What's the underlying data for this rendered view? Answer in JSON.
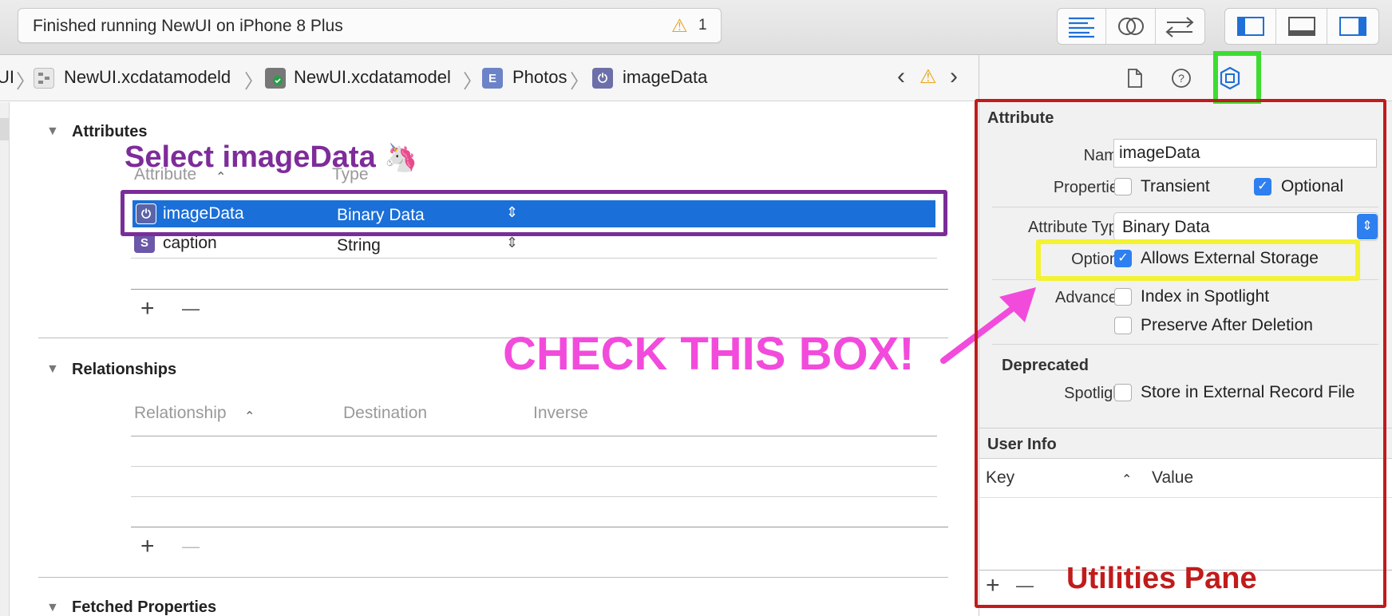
{
  "toolbar": {
    "status_text": "Finished running NewUI on iPhone 8 Plus",
    "warning_icon": "warning-triangle-icon",
    "warning_count": "1",
    "editor_buttons": [
      "standard-editor-icon",
      "assistant-editor-icon",
      "version-editor-icon"
    ],
    "view_buttons": [
      "navigator-toggle-icon",
      "debug-area-toggle-icon",
      "utilities-toggle-icon"
    ]
  },
  "jumpbar": {
    "crumbs": [
      {
        "label": "UI",
        "icon": ""
      },
      {
        "label": "NewUI.xcdatamodeld",
        "icon": "datamodel-bundle-icon"
      },
      {
        "label": "NewUI.xcdatamodel",
        "icon": "datamodel-file-icon"
      },
      {
        "label": "Photos",
        "icon": "entity-icon",
        "icon_letter": "E"
      },
      {
        "label": "imageData",
        "icon": "attribute-icon"
      }
    ],
    "nav_back": "‹",
    "nav_forward": "›"
  },
  "editor": {
    "attributes": {
      "title": "Attributes",
      "columns": [
        "Attribute",
        "Type"
      ],
      "rows": [
        {
          "name": "imageData",
          "type": "Binary Data",
          "icon_letter": "⏻",
          "selected": true
        },
        {
          "name": "caption",
          "type": "String",
          "icon_letter": "S",
          "selected": false
        }
      ]
    },
    "relationships": {
      "title": "Relationships",
      "columns": [
        "Relationship",
        "Destination",
        "Inverse"
      ]
    },
    "fetched_properties": {
      "title": "Fetched Properties"
    },
    "add_label": "+",
    "remove_label": "—"
  },
  "inspector": {
    "tab_icons": [
      "file-inspector-icon",
      "quick-help-icon",
      "data-model-inspector-icon"
    ],
    "section_title": "Attribute",
    "name_label": "Name",
    "name_value": "imageData",
    "properties_label": "Properties",
    "transient_label": "Transient",
    "transient_checked": false,
    "optional_label": "Optional",
    "optional_checked": true,
    "attribute_type_label": "Attribute Type",
    "attribute_type_value": "Binary Data",
    "options_label": "Options",
    "allows_external_label": "Allows External Storage",
    "allows_external_checked": true,
    "advanced_label": "Advanced",
    "index_spotlight_label": "Index in Spotlight",
    "preserve_label": "Preserve After Deletion",
    "deprecated_title": "Deprecated",
    "spotlight_label": "Spotlight",
    "store_external_label": "Store in External Record File",
    "user_info_title": "User Info",
    "key_col": "Key",
    "value_col": "Value",
    "add_label": "+",
    "remove_label": "—"
  },
  "annotations": {
    "select_text": "Select imageData",
    "select_emoji": "🦄",
    "check_text": "CHECK THIS BOX!",
    "utilities_text": "Utilities Pane"
  },
  "colors": {
    "selection_blue": "#1a6fd8",
    "annotation_purple": "#7e2c9a",
    "annotation_magenta": "#f24bdc",
    "annotation_yellow": "#f3f233",
    "annotation_green": "#3cdd2f",
    "annotation_red": "#c11b1b"
  }
}
